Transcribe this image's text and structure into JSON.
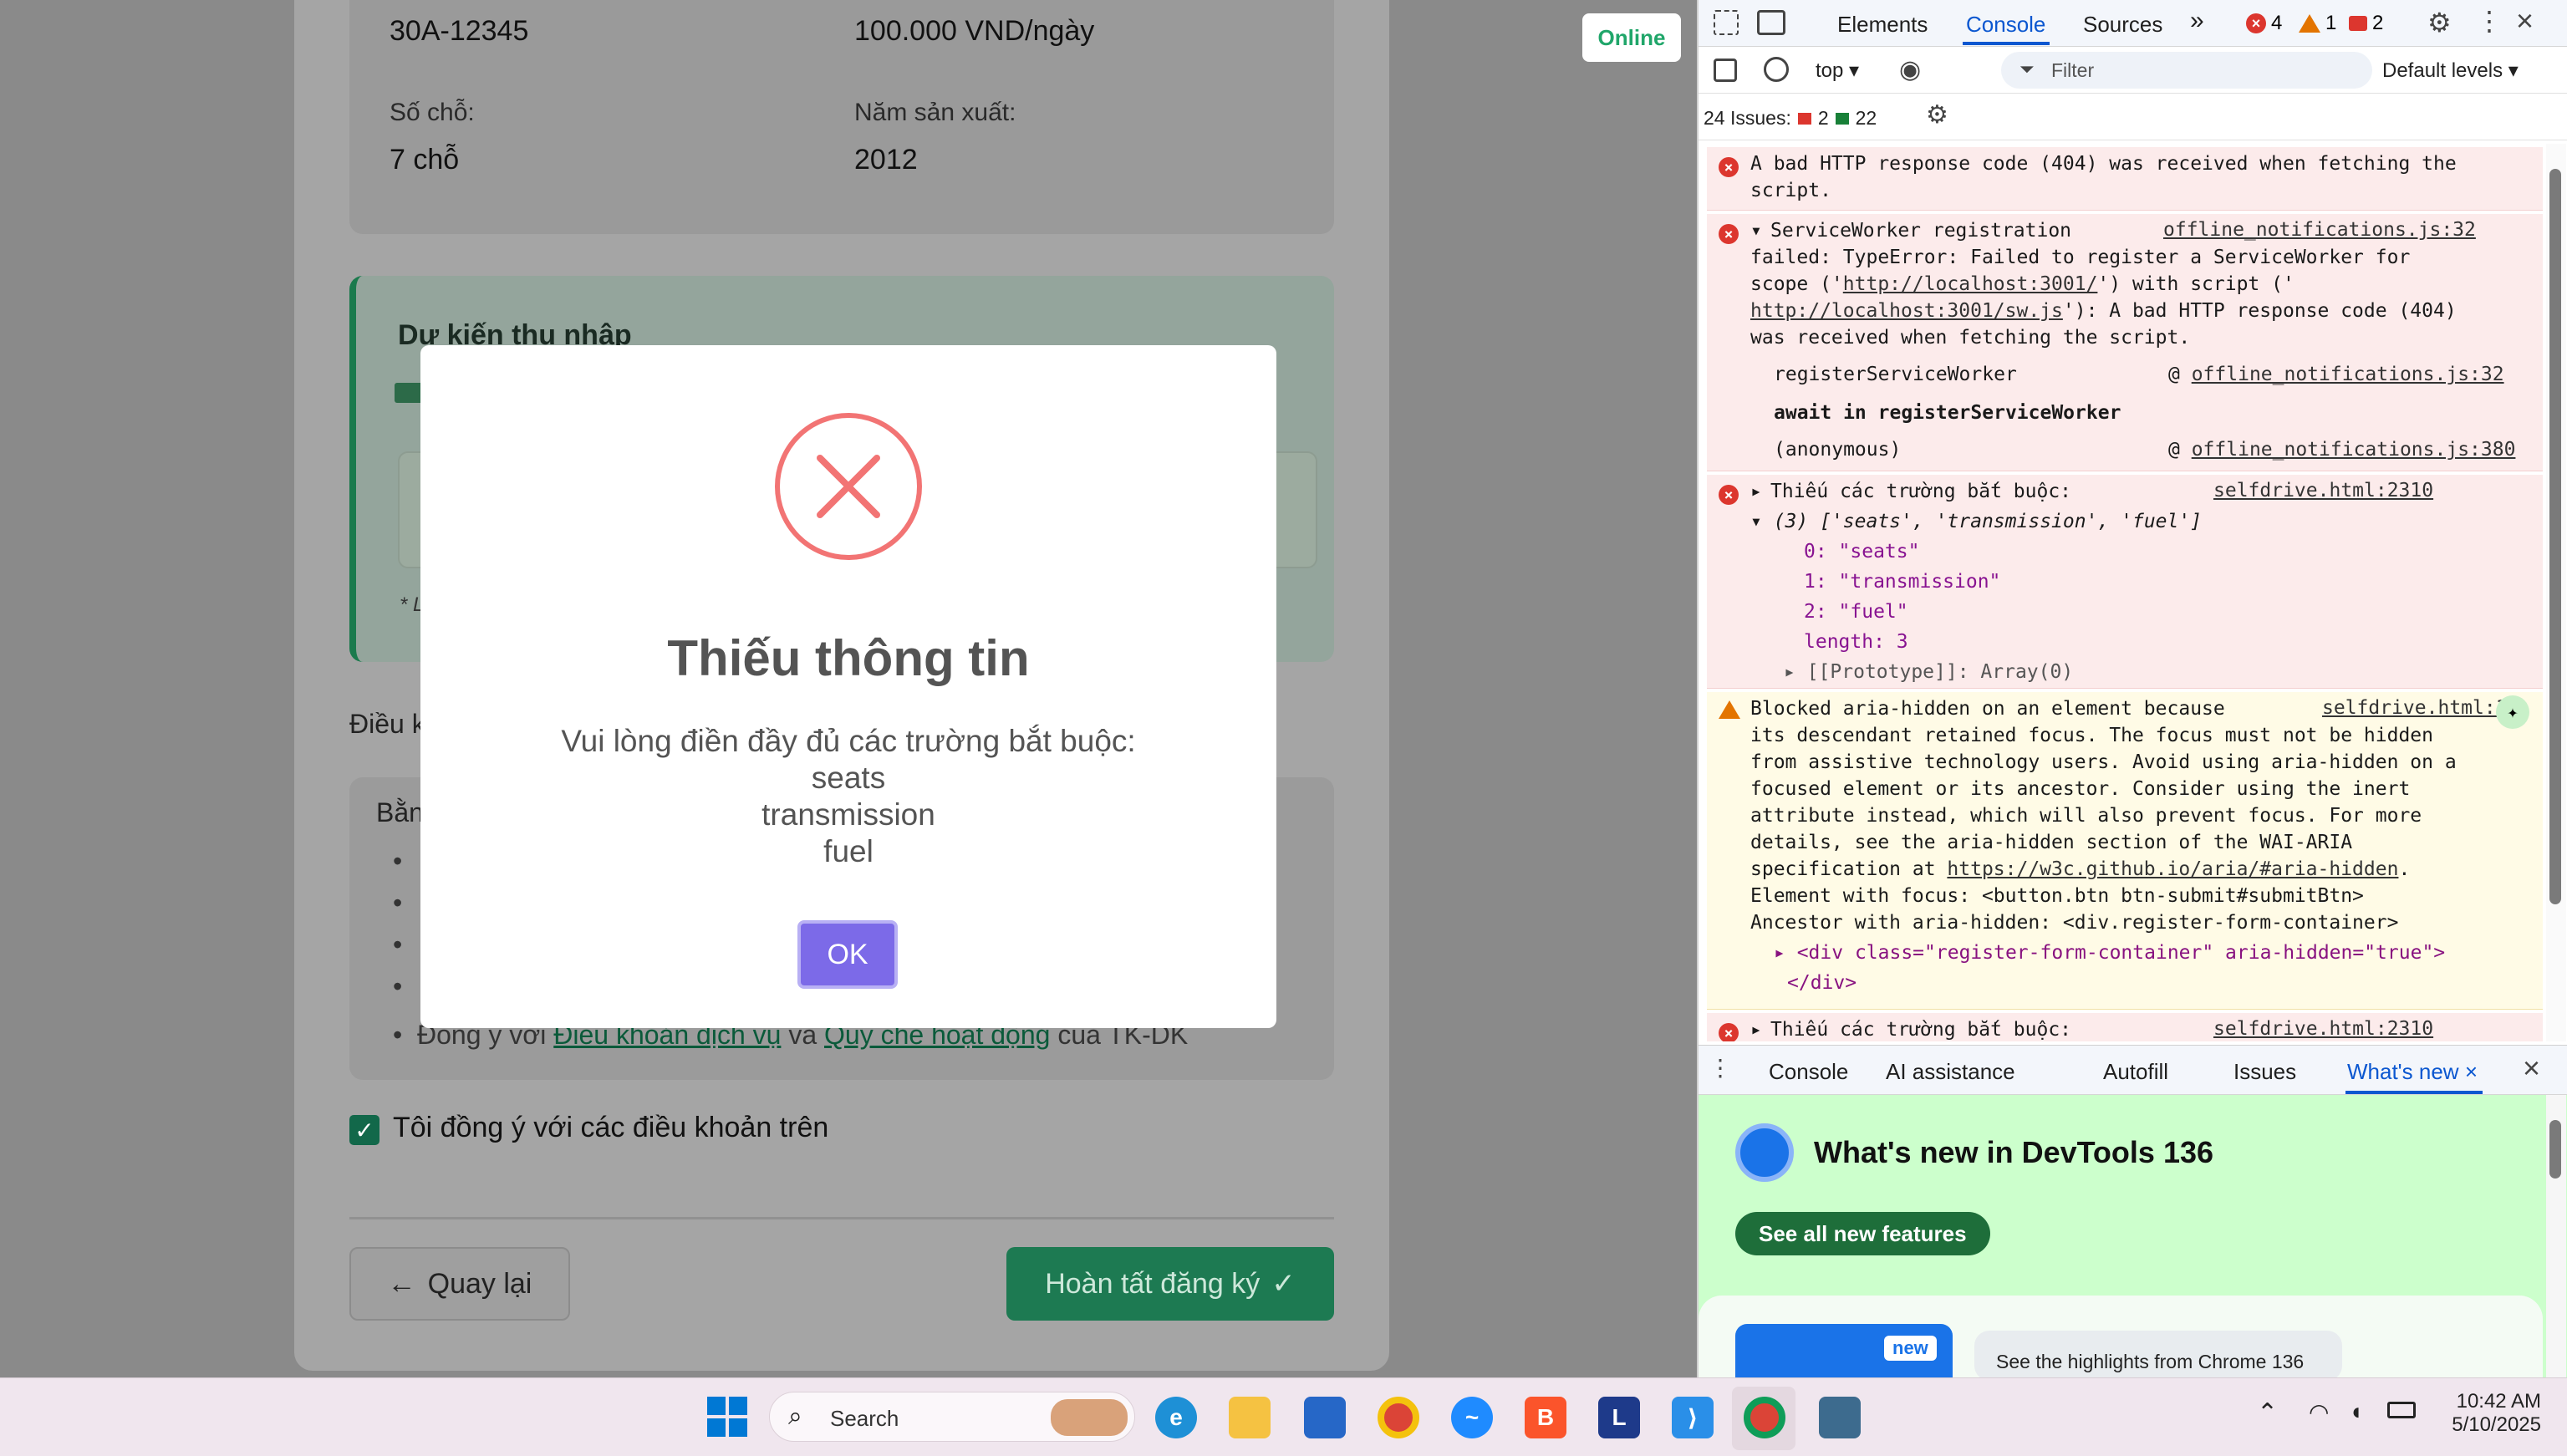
{
  "page": {
    "online_badge": "Online",
    "plate": "30A-12345",
    "price": "100.000 VND/ngày",
    "seats_label": "Số chỗ:",
    "seats_value": "7 chỗ",
    "year_label": "Năm sản xuất:",
    "year_value": "2012",
    "income_title": "Dự kiến thu nhập",
    "income_note_fragment": "* L",
    "terms_title_fragment": "Điều k",
    "terms_box_fragment": "Bằn",
    "terms_last_prefix": "Đồng ý với ",
    "terms_link1": "Điều khoản dịch vụ",
    "terms_mid": " và ",
    "terms_link2": "Quy chế hoạt động",
    "terms_suffix": " của TK-DK",
    "agree_label": "Tôi đồng ý với các điều khoản trên",
    "back_button": "Quay lại",
    "finish_button": "Hoàn tất đăng ký"
  },
  "modal": {
    "title": "Thiếu thông tin",
    "message_line1": "Vui lòng điền đầy đủ các trường bắt buộc:",
    "fields": [
      "seats",
      "transmission",
      "fuel"
    ],
    "ok_button": "OK"
  },
  "devtools": {
    "tabs": [
      "Elements",
      "Console",
      "Sources"
    ],
    "active_tab": "Console",
    "error_count": "4",
    "warning_count": "1",
    "issue_count": "2",
    "context": "top",
    "filter_placeholder": "Filter",
    "levels": "Default levels",
    "issues_label": "24 Issues:",
    "issues_err": "2",
    "issues_info": "22",
    "messages": {
      "m1": "A bad HTTP response code (404) was received when fetching the script.",
      "m2_head": "ServiceWorker registration",
      "m2_src": "offline_notifications.js:32",
      "m2_body1": "failed: TypeError: Failed to register a ServiceWorker for",
      "m2_body2a": "scope ('",
      "m2_url1": "http://localhost:3001/",
      "m2_body2b": "') with script ('",
      "m2_url2": "http://localhost:3001/sw.js",
      "m2_body3": "'): A bad HTTP response code (404)",
      "m2_body4": "was received when fetching the script.",
      "stack1_fn": "registerServiceWorker",
      "stack1_src": "offline_notifications.js:32",
      "stack_await": "await in registerServiceWorker",
      "stack2_fn": "(anonymous)",
      "stack2_src": "offline_notifications.js:380",
      "m3_head": "Thiếu các trường bắt buộc:",
      "m3_src": "selfdrive.html:2310",
      "m3_array": "(3) ['seats', 'transmission', 'fuel']",
      "m3_i0": "0: \"seats\"",
      "m3_i1": "1: \"transmission\"",
      "m3_i2": "2: \"fuel\"",
      "m3_len": "length: 3",
      "m3_proto": "[[Prototype]]: Array(0)",
      "w_src": "selfdrive.html:1",
      "w_l1": "Blocked aria-hidden on an element because",
      "w_l2": "its descendant retained focus. The focus must not be hidden",
      "w_l3": "from assistive technology users. Avoid using aria-hidden on a",
      "w_l4": "focused element or its ancestor. Consider using the inert",
      "w_l5": "attribute instead, which will also prevent focus. For more",
      "w_l6": "details, see the aria-hidden section of the WAI-ARIA",
      "w_l7a": "specification at ",
      "w_l7_url": "https://w3c.github.io/aria/#aria-hidden",
      "w_l8": "Element with focus: <button.btn btn-submit#submitBtn>",
      "w_l9": "Ancestor with aria-hidden: <div.register-form-container>",
      "w_l10": "<div class=\"register-form-container\" aria-hidden=\"true\">",
      "w_l11": "</div>",
      "m4_head": "Thiếu các trường bắt buộc:",
      "m4_src": "selfdrive.html:2310"
    },
    "drawer_tabs": [
      "Console",
      "AI assistance",
      "Autofill",
      "Issues",
      "What's new"
    ],
    "whatsnew_title": "What's new in DevTools 136",
    "see_all": "See all new features",
    "new_badge": "new",
    "highlights": "See the highlights from Chrome 136"
  },
  "taskbar": {
    "search_placeholder": "Search",
    "time": "10:42 AM",
    "date": "5/10/2025"
  }
}
